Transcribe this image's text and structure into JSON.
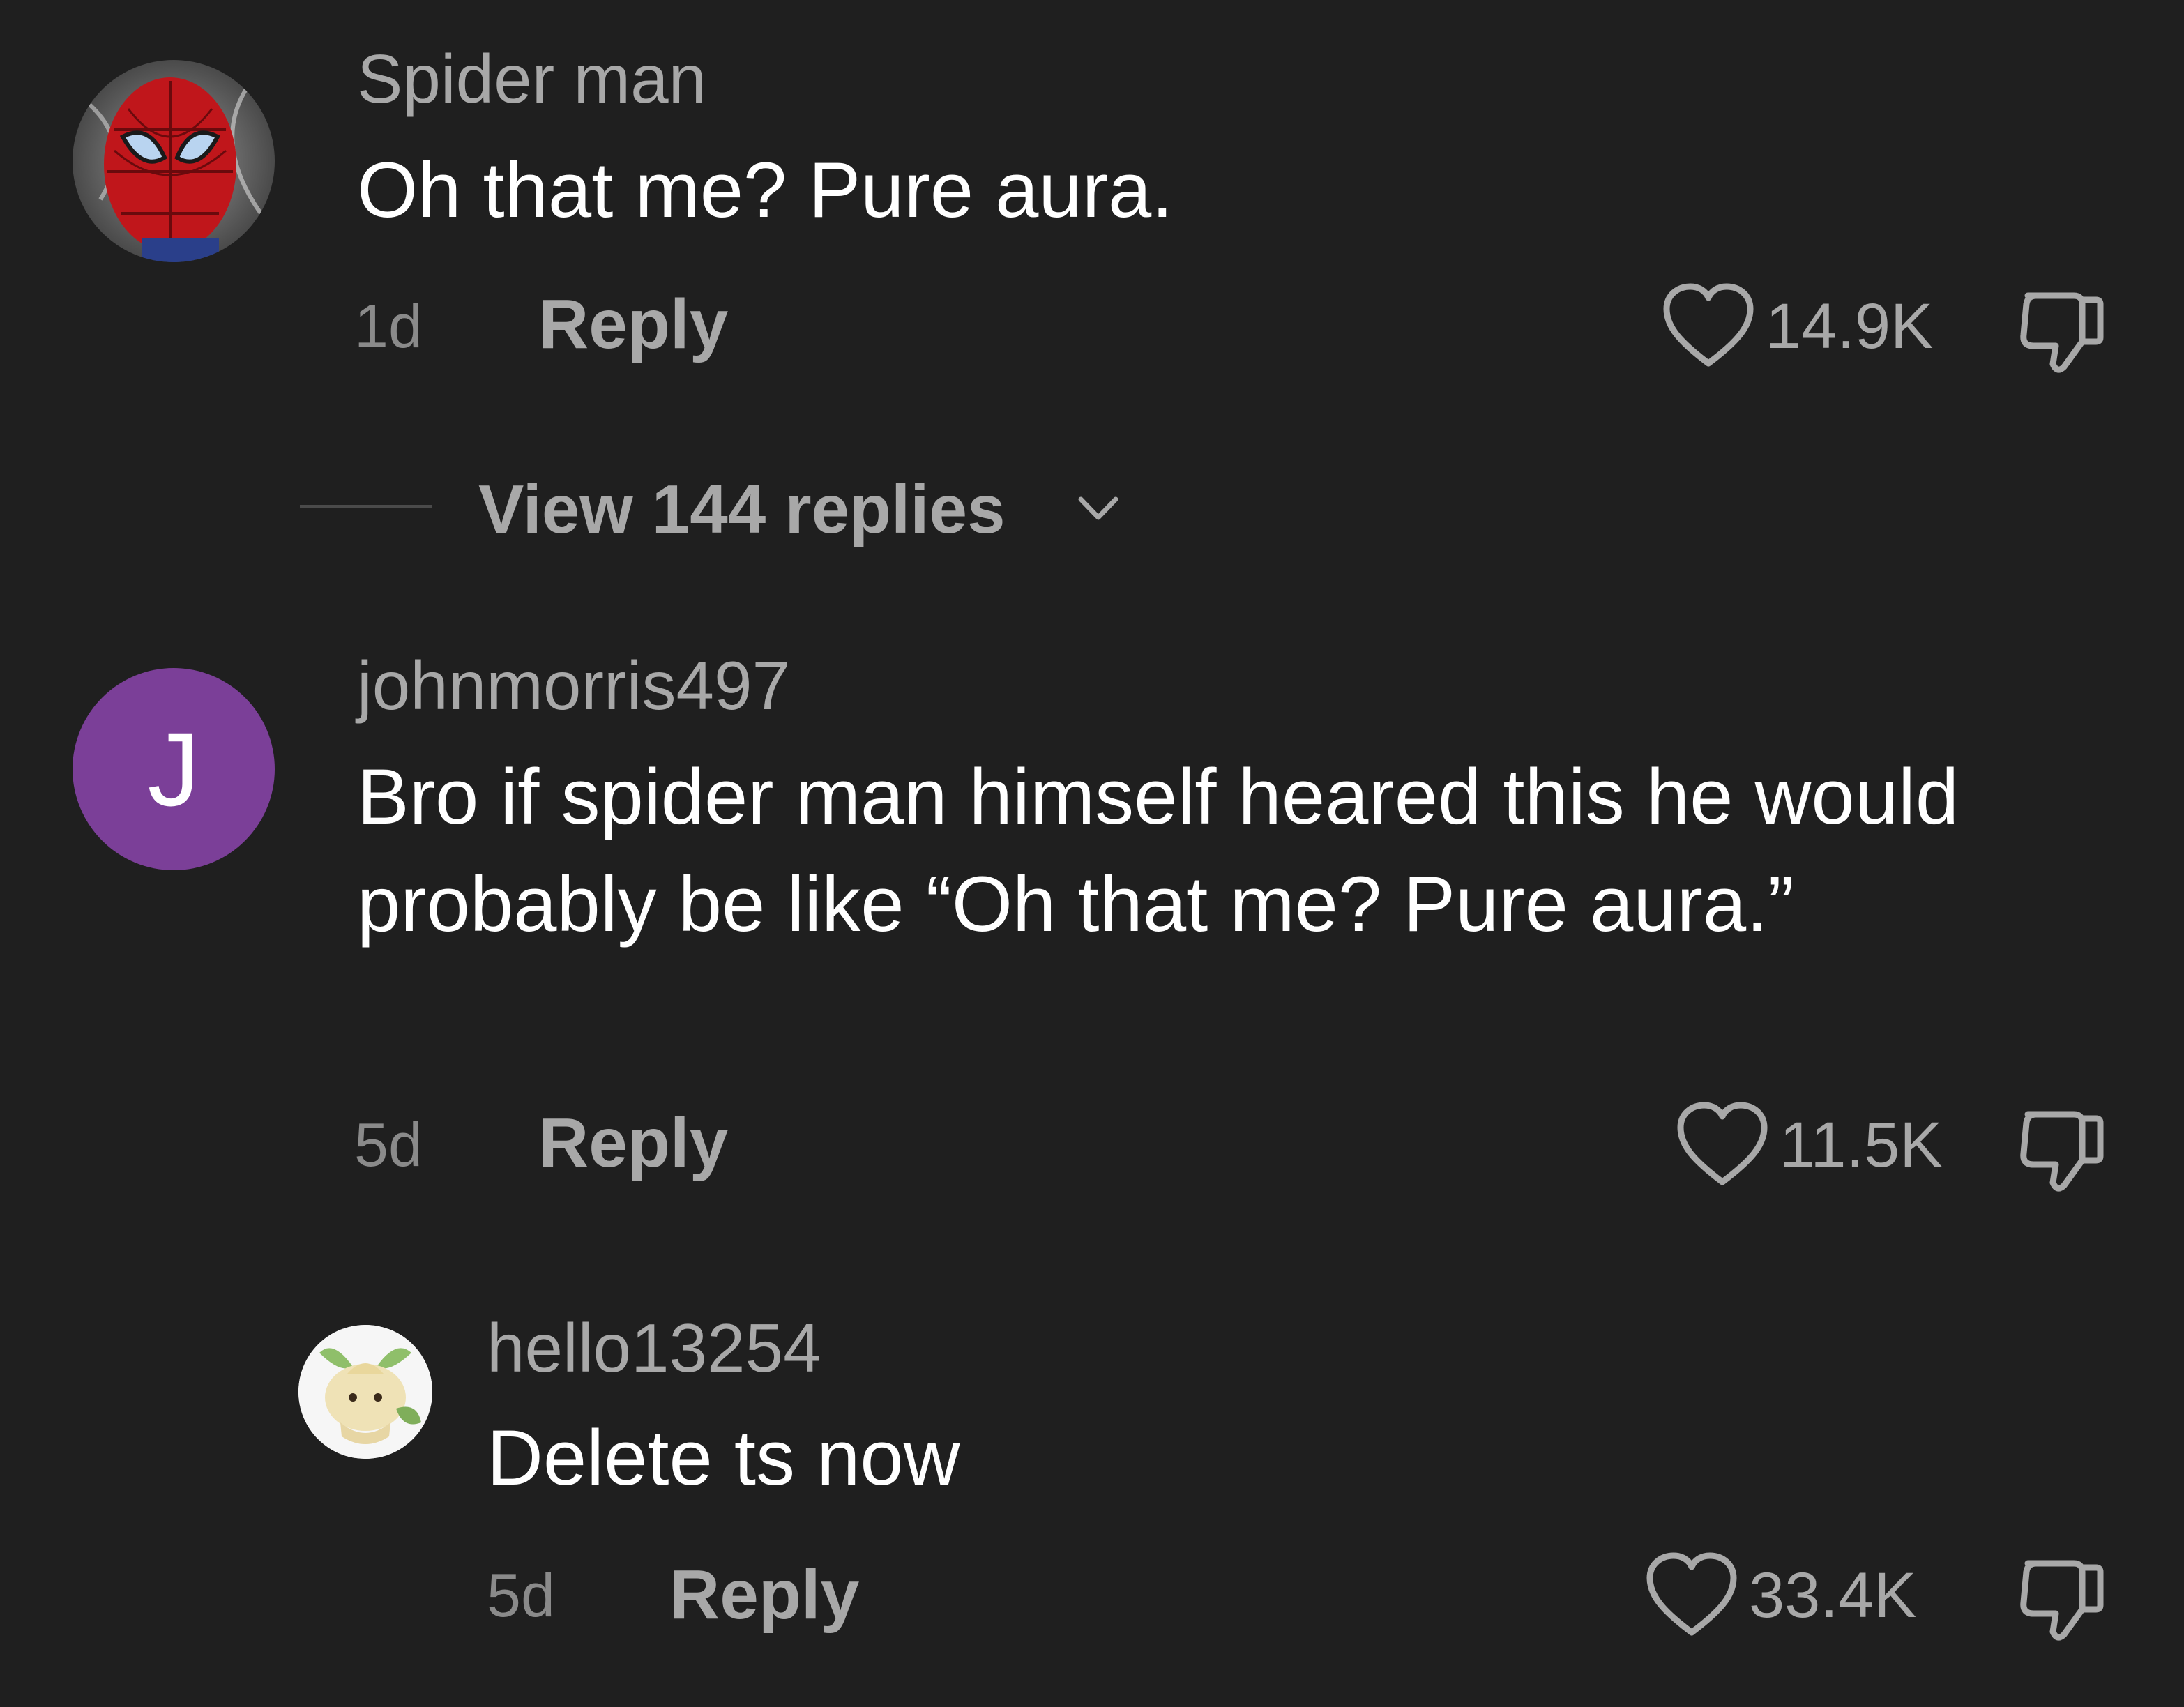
{
  "comments": [
    {
      "username": "Spider man",
      "text": "Oh that me? Pure aura.",
      "time": "1d",
      "reply_label": "Reply",
      "likes": "14.9K",
      "avatar": "spider-man-photo"
    },
    {
      "username": "johnmorris497",
      "text": "Bro if spider man himself heared this he would probably be like “Oh that me? Pure aura.”",
      "time": "5d",
      "reply_label": "Reply",
      "likes": "11.5K",
      "avatar_letter": "J",
      "avatar_color": "#7b3f98"
    },
    {
      "username": "hello13254",
      "text": "Delete ts now",
      "time": "5d",
      "reply_label": "Reply",
      "likes": "33.4K",
      "avatar": "leafeon-creature"
    }
  ],
  "view_replies": {
    "label": "View 144 replies"
  },
  "colors": {
    "background": "#1f1f1f",
    "primary_text": "#ffffff",
    "secondary_text": "#a8a8a8",
    "avatar_purple": "#7b3f98"
  },
  "icons": [
    "heart-icon",
    "dislike-icon",
    "chevron-down-icon"
  ]
}
